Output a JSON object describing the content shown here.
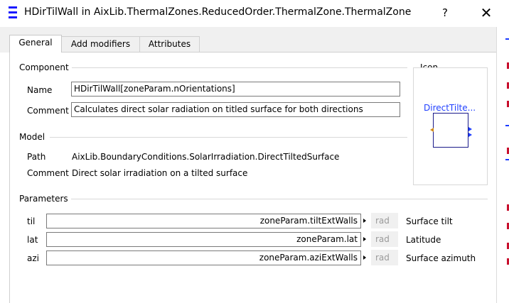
{
  "window": {
    "title": "HDirTilWall in AixLib.ThermalZones.ReducedOrder.ThermalZone.ThermalZone",
    "help_label": "?",
    "close_label": "✕"
  },
  "tabs": [
    {
      "label": "General",
      "active": true
    },
    {
      "label": "Add modifiers",
      "active": false
    },
    {
      "label": "Attributes",
      "active": false
    }
  ],
  "component": {
    "group_title": "Component",
    "name_label": "Name",
    "name_value": "HDirTilWall[zoneParam.nOrientations]",
    "comment_label": "Comment",
    "comment_value": "Calculates direct solar radiation on titled surface for both directions"
  },
  "icon": {
    "group_title": "Icon",
    "name": "DirectTilte...",
    "colors": {
      "frame": "#1a1a8a",
      "text": "#1f3fff",
      "input": "#d08a1a"
    }
  },
  "model": {
    "group_title": "Model",
    "path_label": "Path",
    "path_value": "AixLib.BoundaryConditions.SolarIrradiation.DirectTiltedSurface",
    "comment_label": "Comment",
    "comment_value": "Direct solar irradiation on a tilted surface"
  },
  "parameters": {
    "group_title": "Parameters",
    "rows": [
      {
        "name": "til",
        "value": "zoneParam.tiltExtWalls",
        "unit": "rad",
        "description": "Surface tilt"
      },
      {
        "name": "lat",
        "value": "zoneParam.lat",
        "unit": "rad",
        "description": "Latitude"
      },
      {
        "name": "azi",
        "value": "zoneParam.aziExtWalls",
        "unit": "rad",
        "description": "Surface azimuth"
      }
    ]
  }
}
